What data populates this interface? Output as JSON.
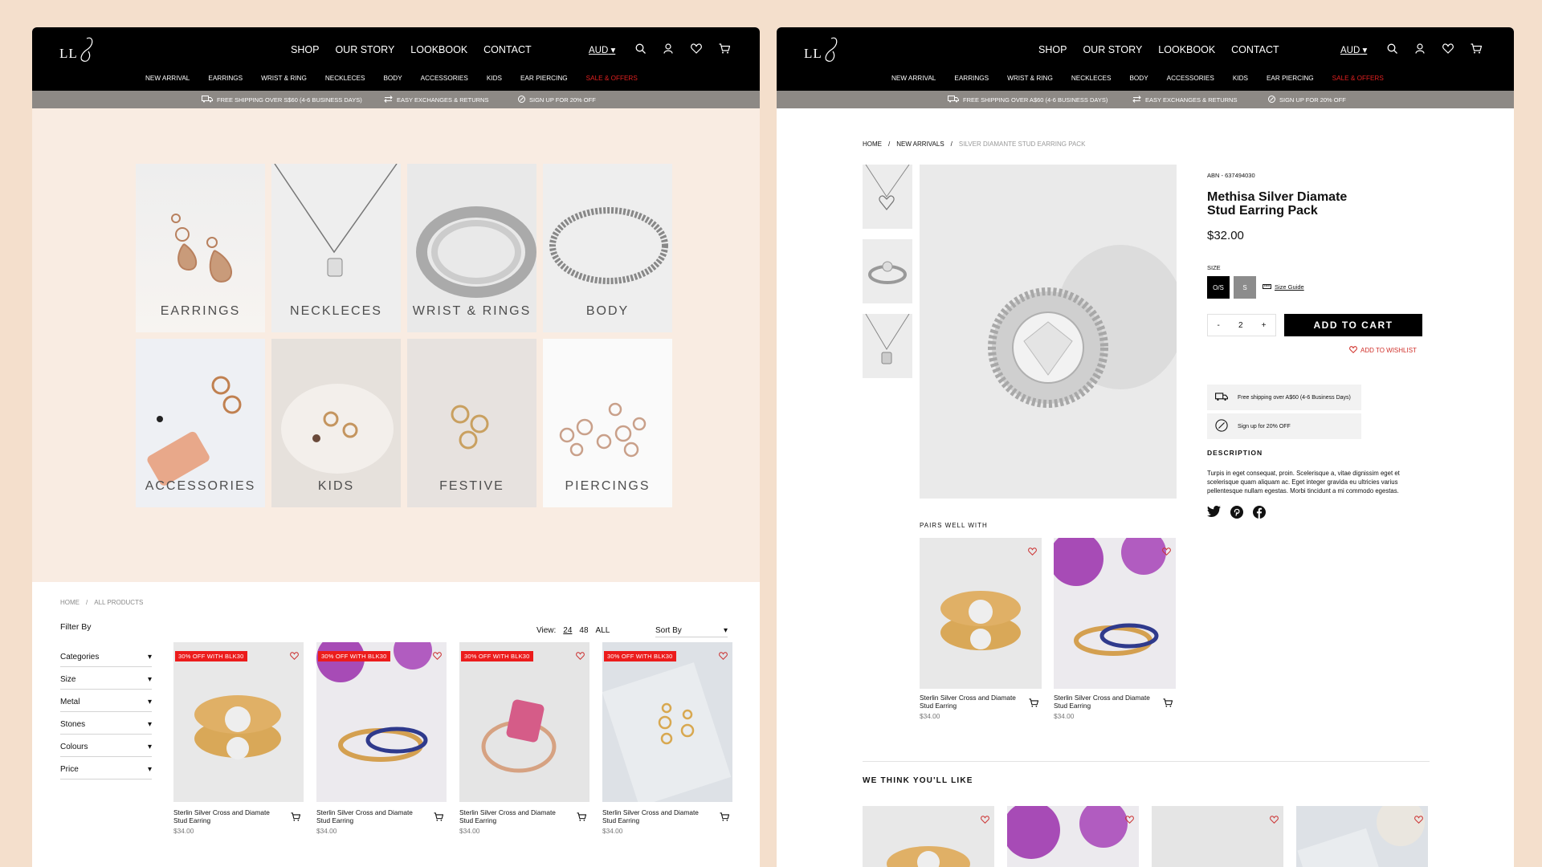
{
  "site": {
    "logo_text": "LL",
    "nav": [
      "SHOP",
      "OUR STORY",
      "LOOKBOOK",
      "CONTACT"
    ],
    "currency": "AUD",
    "subnav": [
      "NEW ARRIVAL",
      "EARRINGS",
      "WRIST & RING",
      "NECKLECES",
      "BODY",
      "ACCESSORIES",
      "KIDS",
      "EAR PIERCING",
      "SALE & OFFERS"
    ],
    "icons": [
      "search-icon",
      "user-icon",
      "heart-icon",
      "cart-icon"
    ],
    "colors": {
      "bar": "#000000",
      "promo": "#8d8985",
      "sale": "#e02020",
      "badge": "#ec1c1c",
      "bg": "#f4dfcc"
    }
  },
  "left": {
    "promo": [
      "FREE SHIPPING OVER S$60 (4-6 BUSINESS DAYS)",
      "EASY EXCHANGES & RETURNS",
      "SIGN UP FOR 20% OFF"
    ],
    "categories": [
      "EARRINGS",
      "NECKLECES",
      "WRIST & RINGS",
      "BODY",
      "ACCESSORIES",
      "KIDS",
      "FESTIVE",
      "PIERCINGS"
    ],
    "breadcrumb": [
      "HOME",
      "/",
      "ALL PRODUCTS"
    ],
    "filter_by": "Filter By",
    "filters": [
      "Categories",
      "Size",
      "Metal",
      "Stones",
      "Colours",
      "Price"
    ],
    "view_label": "View:",
    "view_options": [
      "24",
      "48",
      "ALL"
    ],
    "sort_label": "Sort By",
    "products": [
      {
        "badge": "30% OFF WITH BLK30",
        "name": "Sterlin Silver Cross and Diamate Stud Earring",
        "price": "$34.00"
      },
      {
        "badge": "30% OFF WITH BLK30",
        "name": "Sterlin Silver Cross and Diamate Stud Earring",
        "price": "$34.00"
      },
      {
        "badge": "30% OFF WITH BLK30",
        "name": "Sterlin Silver Cross and Diamate Stud Earring",
        "price": "$34.00"
      },
      {
        "badge": "30% OFF WITH BLK30",
        "name": "Sterlin Silver Cross and Diamate Stud Earring",
        "price": "$34.00"
      }
    ]
  },
  "right": {
    "promo": [
      "FREE SHIPPING OVER A$60 (4-6 BUSINESS DAYS)",
      "EASY EXCHANGES & RETURNS",
      "SIGN UP FOR 20% OFF"
    ],
    "breadcrumb": [
      "HOME",
      "/",
      "NEW ARRIVALS",
      "/",
      "SILVER DIAMANTE STUD EARRING PACK"
    ],
    "abn": "ABN - 637494030",
    "title": "Methisa Silver Diamate Stud Earring Pack",
    "price": "$32.00",
    "size_label": "SIZE",
    "sizes": [
      "O/S",
      "S"
    ],
    "size_guide": "Size Guide",
    "qty": {
      "minus": "-",
      "value": "2",
      "plus": "+"
    },
    "add_to_cart": "ADD TO CART",
    "wishlist": "ADD TO WISHLIST",
    "info": [
      "Free shipping over A$60 (4-6 Business Days)",
      "Sign up for 20% OFF"
    ],
    "description_label": "DESCRIPTION",
    "description": "Turpis in eget consequat, proin. Scelerisque a, vitae dignissim eget et scelerisque quam aliquam ac. Eget integer gravida eu ultricies varius pellentesque nullam egestas. Morbi tincidunt a mi commodo egestas.",
    "pairs_label": "PAIRS WELL WITH",
    "pairs": [
      {
        "name": "Sterlin Silver Cross and Diamate Stud Earring",
        "price": "$34.00"
      },
      {
        "name": "Sterlin Silver Cross and Diamate Stud Earring",
        "price": "$34.00"
      }
    ],
    "like_label": "WE THINK YOU'LL LIKE"
  }
}
